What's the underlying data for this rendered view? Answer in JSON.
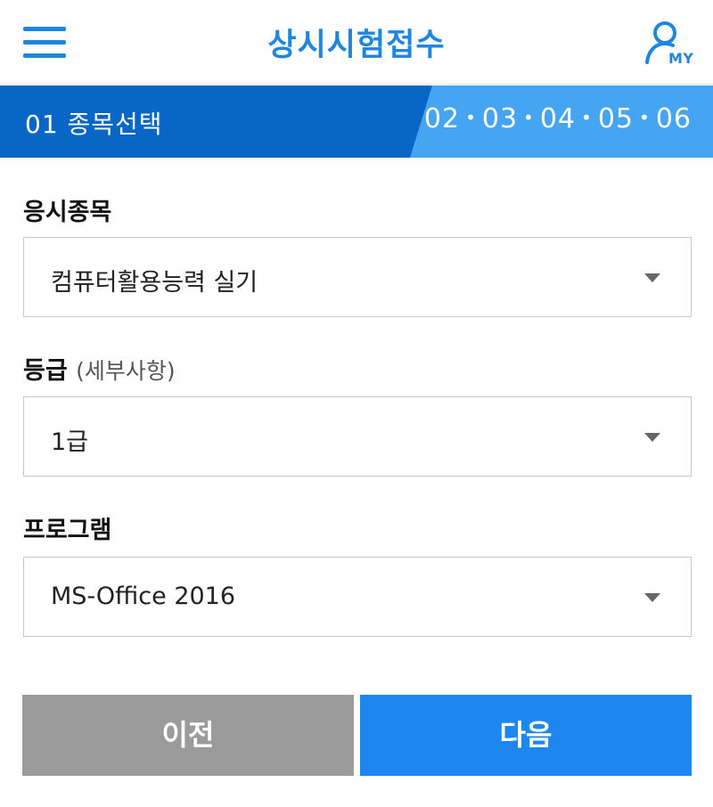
{
  "header": {
    "title": "상시시험접수",
    "my_label": "MY",
    "menu_icon": "hamburger-menu-icon",
    "user_icon": "user-icon",
    "accent_color": "#1f86e0"
  },
  "steps": {
    "current": "01 종목선택",
    "remaining": [
      "02",
      "03",
      "04",
      "05",
      "06"
    ],
    "current_color": "#0866c6",
    "rest_color": "#45a5f3"
  },
  "form": {
    "subject": {
      "label": "응시종목",
      "value": "컴퓨터활용능력 실기"
    },
    "grade": {
      "label": "등급",
      "label_sub": "(세부사항)",
      "value": "1급"
    },
    "program": {
      "label": "프로그램",
      "value": "MS-Office 2016"
    }
  },
  "buttons": {
    "prev": "이전",
    "next": "다음",
    "prev_color": "#9b9b9b",
    "next_color": "#1d87ef"
  }
}
